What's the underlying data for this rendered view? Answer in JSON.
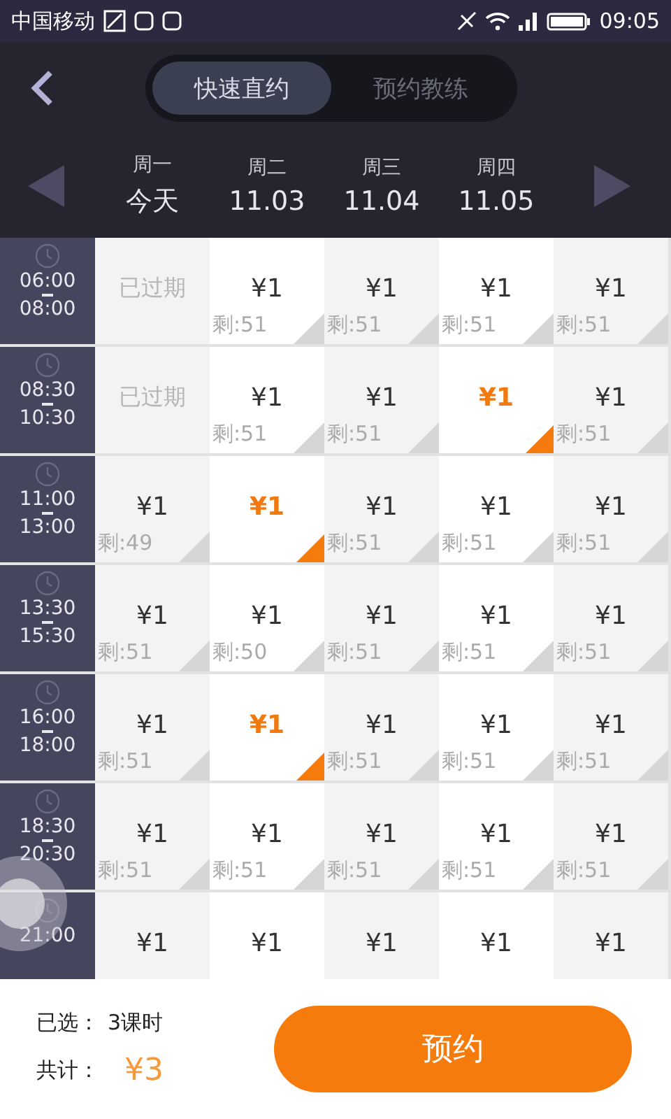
{
  "status_bar": {
    "carrier": "中国移动",
    "time": "09:05"
  },
  "tabs": [
    {
      "label": "快速直约",
      "selected": true
    },
    {
      "label": "预约教练",
      "selected": false
    }
  ],
  "days": [
    {
      "weekday": "周一",
      "date": "今天"
    },
    {
      "weekday": "周二",
      "date": "11.03"
    },
    {
      "weekday": "周三",
      "date": "11.04"
    },
    {
      "weekday": "周四",
      "date": "11.05"
    }
  ],
  "slots": [
    {
      "start": "06:00",
      "end": "08:00",
      "cells": [
        {
          "kind": "expired",
          "label": "已过期"
        },
        {
          "kind": "slot",
          "price": "¥1",
          "remaining": "剩:51",
          "selected": false
        },
        {
          "kind": "slot",
          "price": "¥1",
          "remaining": "剩:51",
          "selected": false
        },
        {
          "kind": "slot",
          "price": "¥1",
          "remaining": "剩:51",
          "selected": false
        },
        {
          "kind": "slot",
          "price": "¥1",
          "remaining": "剩:51",
          "selected": false
        }
      ]
    },
    {
      "start": "08:30",
      "end": "10:30",
      "cells": [
        {
          "kind": "expired",
          "label": "已过期"
        },
        {
          "kind": "slot",
          "price": "¥1",
          "remaining": "剩:51",
          "selected": false
        },
        {
          "kind": "slot",
          "price": "¥1",
          "remaining": "剩:51",
          "selected": false
        },
        {
          "kind": "slot",
          "price": "¥1",
          "selected": true
        },
        {
          "kind": "slot",
          "price": "¥1",
          "remaining": "剩:51",
          "selected": false
        }
      ]
    },
    {
      "start": "11:00",
      "end": "13:00",
      "cells": [
        {
          "kind": "slot",
          "price": "¥1",
          "remaining": "剩:49",
          "selected": false
        },
        {
          "kind": "slot",
          "price": "¥1",
          "selected": true
        },
        {
          "kind": "slot",
          "price": "¥1",
          "remaining": "剩:51",
          "selected": false
        },
        {
          "kind": "slot",
          "price": "¥1",
          "remaining": "剩:51",
          "selected": false
        },
        {
          "kind": "slot",
          "price": "¥1",
          "remaining": "剩:51",
          "selected": false
        }
      ]
    },
    {
      "start": "13:30",
      "end": "15:30",
      "cells": [
        {
          "kind": "slot",
          "price": "¥1",
          "remaining": "剩:51",
          "selected": false
        },
        {
          "kind": "slot",
          "price": "¥1",
          "remaining": "剩:50",
          "selected": false
        },
        {
          "kind": "slot",
          "price": "¥1",
          "remaining": "剩:51",
          "selected": false
        },
        {
          "kind": "slot",
          "price": "¥1",
          "remaining": "剩:51",
          "selected": false
        },
        {
          "kind": "slot",
          "price": "¥1",
          "remaining": "剩:51",
          "selected": false
        }
      ]
    },
    {
      "start": "16:00",
      "end": "18:00",
      "cells": [
        {
          "kind": "slot",
          "price": "¥1",
          "remaining": "剩:51",
          "selected": false
        },
        {
          "kind": "slot",
          "price": "¥1",
          "selected": true
        },
        {
          "kind": "slot",
          "price": "¥1",
          "remaining": "剩:51",
          "selected": false
        },
        {
          "kind": "slot",
          "price": "¥1",
          "remaining": "剩:51",
          "selected": false
        },
        {
          "kind": "slot",
          "price": "¥1",
          "remaining": "剩:51",
          "selected": false
        }
      ]
    },
    {
      "start": "18:30",
      "end": "20:30",
      "cells": [
        {
          "kind": "slot",
          "price": "¥1",
          "remaining": "剩:51",
          "selected": false
        },
        {
          "kind": "slot",
          "price": "¥1",
          "remaining": "剩:51",
          "selected": false
        },
        {
          "kind": "slot",
          "price": "¥1",
          "remaining": "剩:51",
          "selected": false
        },
        {
          "kind": "slot",
          "price": "¥1",
          "remaining": "剩:51",
          "selected": false
        },
        {
          "kind": "slot",
          "price": "¥1",
          "remaining": "剩:51",
          "selected": false
        }
      ]
    },
    {
      "start": "21:00",
      "cells": [
        {
          "kind": "slot",
          "price": "¥1",
          "selected": false
        },
        {
          "kind": "slot",
          "price": "¥1",
          "selected": false
        },
        {
          "kind": "slot",
          "price": "¥1",
          "selected": false
        },
        {
          "kind": "slot",
          "price": "¥1",
          "selected": false
        },
        {
          "kind": "slot",
          "price": "¥1",
          "selected": false
        }
      ]
    }
  ],
  "summary": {
    "selected_label": "已选：",
    "selected_value": "3课时",
    "total_label": "共计：",
    "total_value": "¥3"
  },
  "book_button": "预约"
}
